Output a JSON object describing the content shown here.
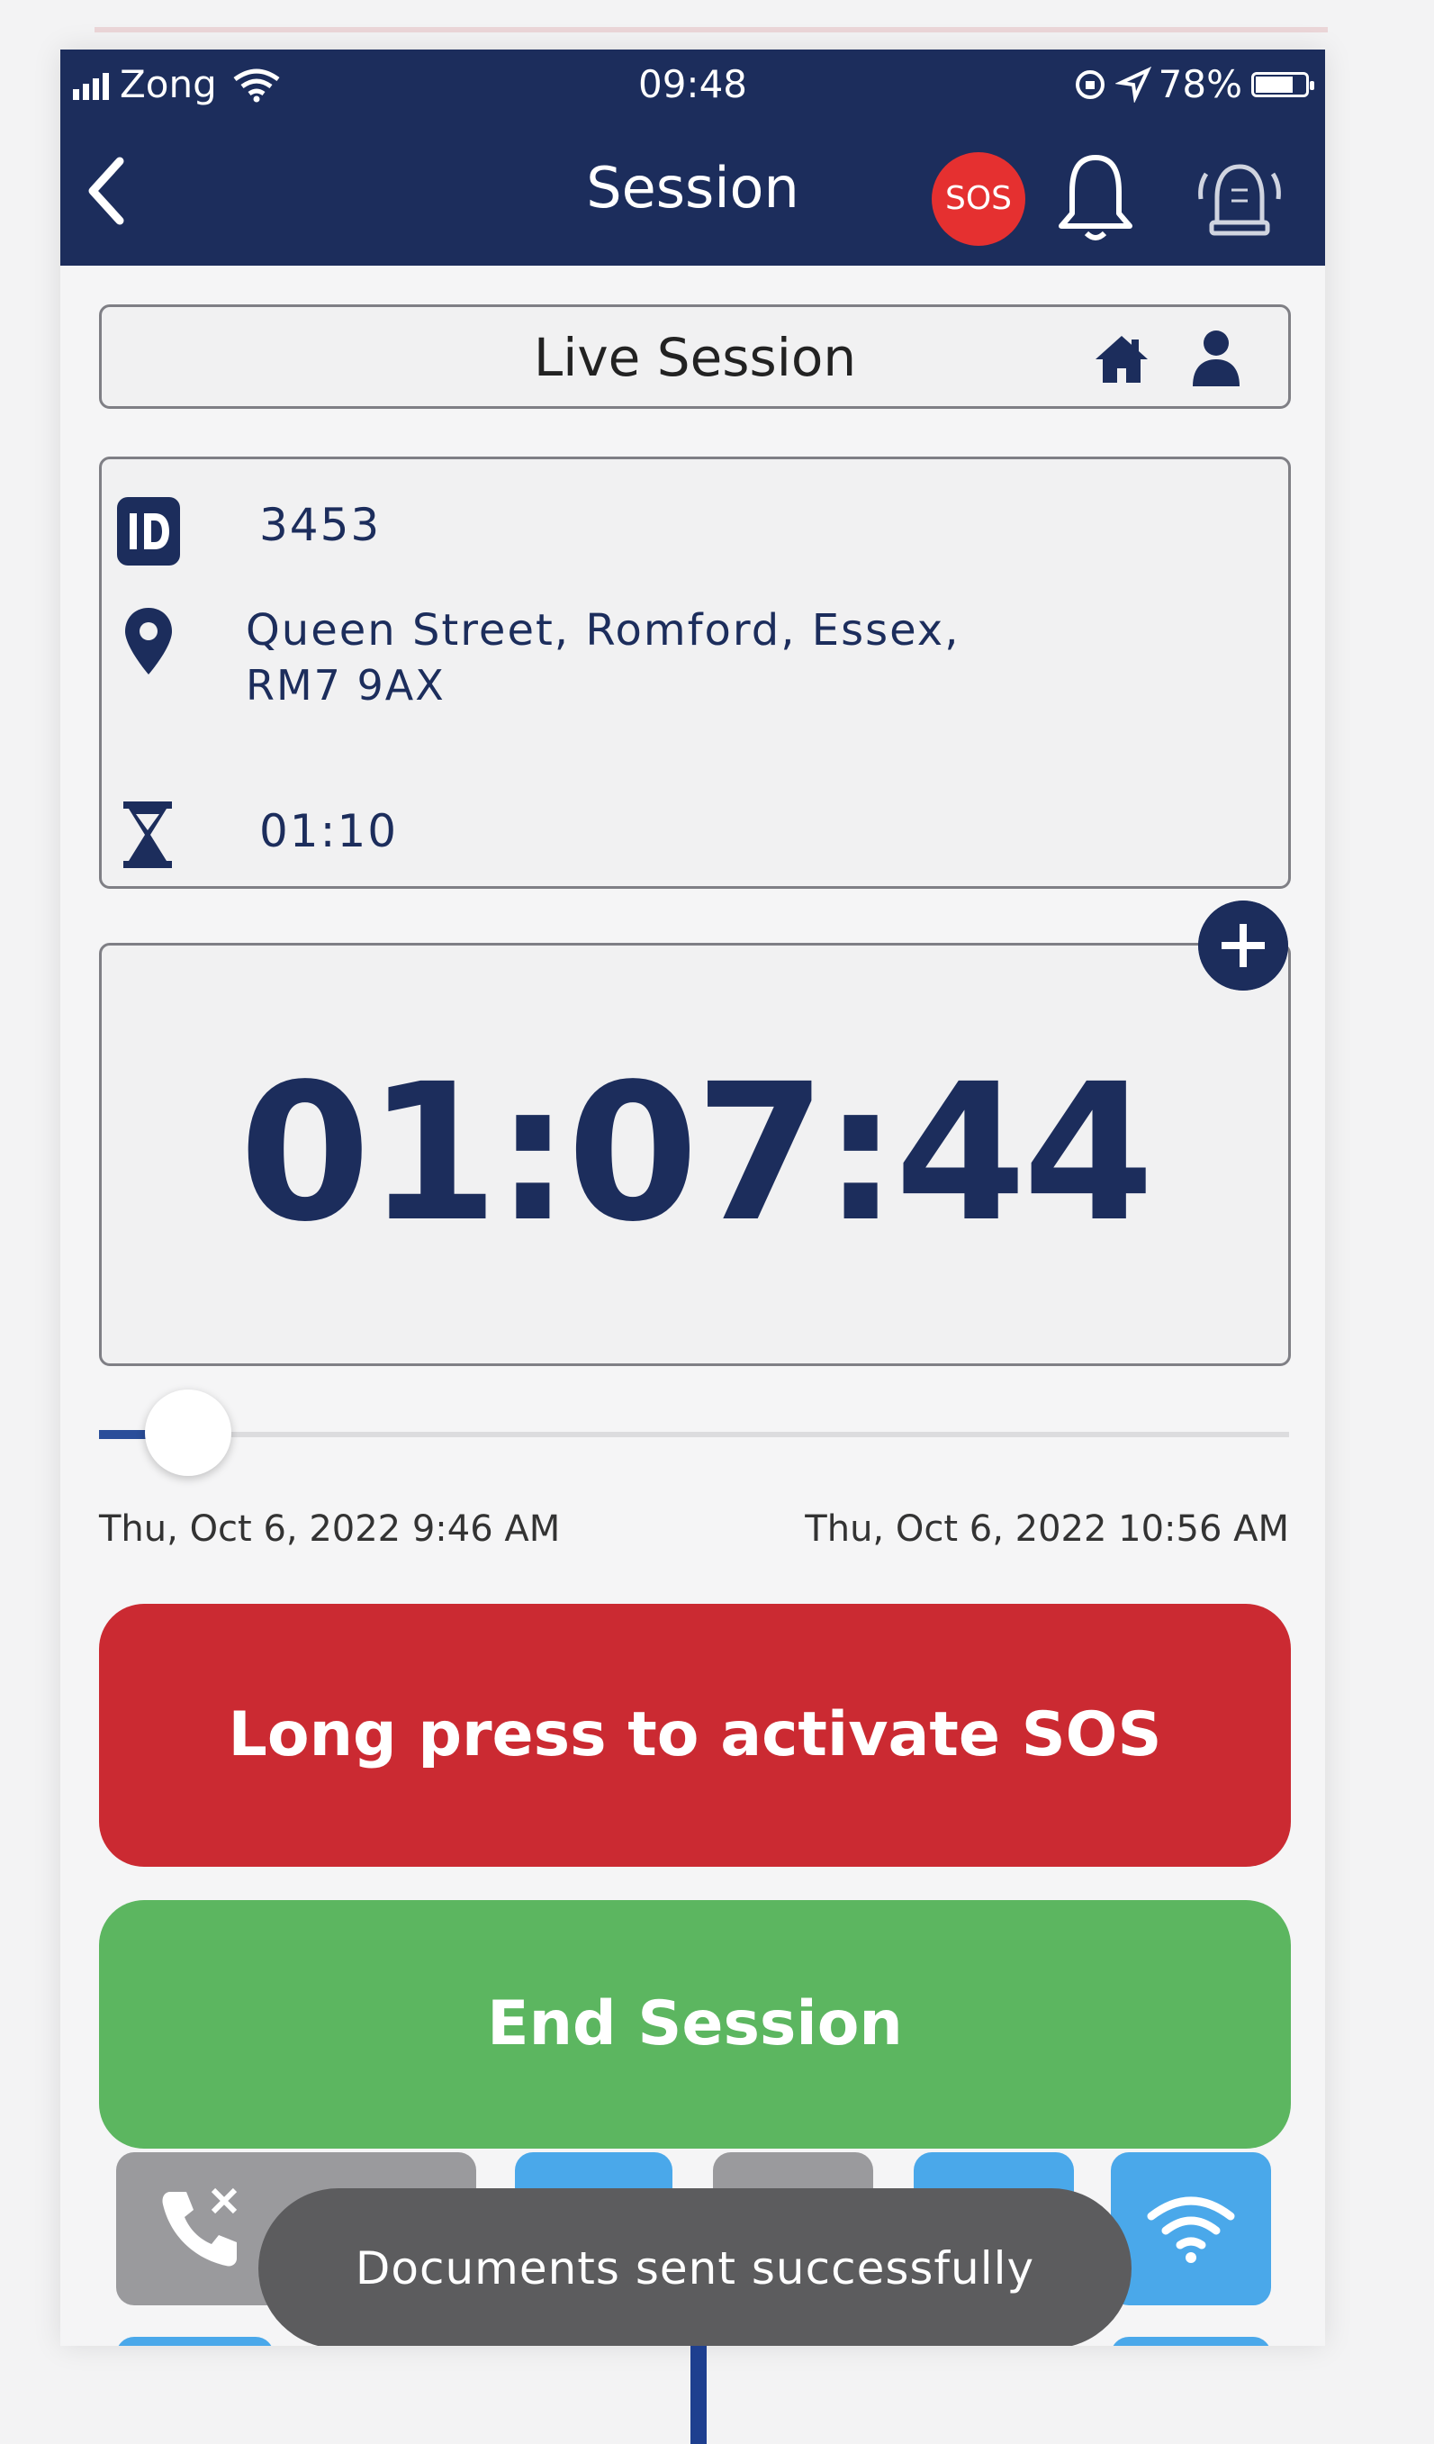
{
  "status_bar": {
    "carrier": "Zong",
    "time": "09:48",
    "battery": "78%"
  },
  "header": {
    "title": "Session",
    "sos_badge": "SOS"
  },
  "live_session": {
    "label": "Live Session"
  },
  "info": {
    "id": "3453",
    "address_line1": "Queen Street, Romford, Essex,",
    "address_line2": "RM7 9AX",
    "duration": "01:10"
  },
  "timer": {
    "value": "01:07:44"
  },
  "slider": {
    "progress": 0.06,
    "start_label": "Thu, Oct 6, 2022 9:46 AM",
    "end_label": "Thu, Oct 6, 2022 10:56 AM"
  },
  "buttons": {
    "sos": "Long press to activate SOS",
    "end": "End Session"
  },
  "toast": {
    "message": "Documents sent successfully"
  },
  "colors": {
    "navy": "#1c2d5c",
    "sos_red": "#cb2a32",
    "end_green": "#5cb660",
    "tile_blue": "#4aa8ea",
    "tile_gray": "#9a9a9d"
  },
  "icons": [
    "chevron-left-icon",
    "sos-icon",
    "bell-icon",
    "alarm-icon",
    "home-icon",
    "person-icon",
    "id-icon",
    "location-pin-icon",
    "hourglass-icon",
    "plus-icon",
    "phone-call-icon",
    "wifi-icon"
  ]
}
